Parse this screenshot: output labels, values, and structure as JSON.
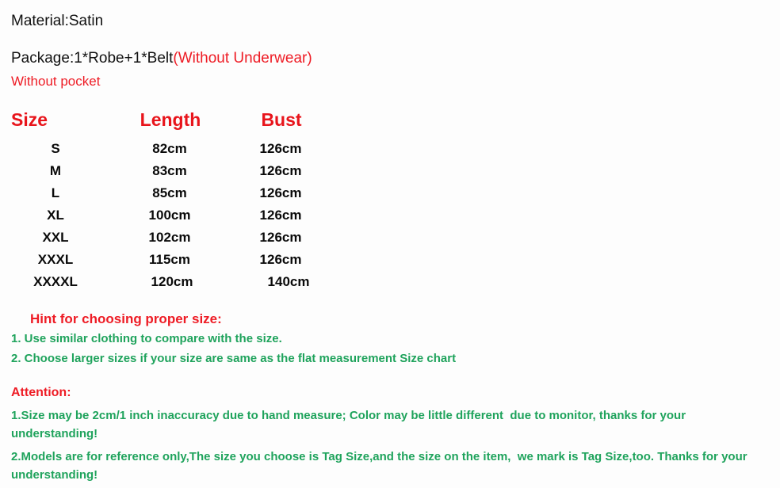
{
  "document": {
    "material_line": "Material:Satin",
    "package": {
      "main": "Package:1*Robe+1*Belt",
      "note": "(Without Underwear)"
    },
    "pocket_line": "Without pocket"
  },
  "size_chart": {
    "headers": {
      "size": "Size",
      "length": "Length",
      "bust": "Bust"
    },
    "rows": [
      {
        "size": "S",
        "length": "82cm",
        "bust": "126cm"
      },
      {
        "size": "M",
        "length": "83cm",
        "bust": "126cm"
      },
      {
        "size": "L",
        "length": "85cm",
        "bust": "126cm"
      },
      {
        "size": "XL",
        "length": "100cm",
        "bust": "126cm"
      },
      {
        "size": "XXL",
        "length": "102cm",
        "bust": "126cm"
      },
      {
        "size": "XXXL",
        "length": "115cm",
        "bust": "126cm"
      },
      {
        "size": "XXXXL",
        "length": "120cm",
        "bust": "140cm"
      }
    ]
  },
  "hint": {
    "title": "Hint for choosing proper size:",
    "items": [
      "1. Use similar clothing to compare with the size.",
      "2. Choose larger sizes if your size are same as the flat measurement Size chart"
    ]
  },
  "attention": {
    "title": "Attention:",
    "items": [
      "1.Size may be 2cm/1 inch inaccuracy due to hand measure; Color may be little different  due to monitor, thanks for your understanding!",
      "2.Models are for reference only,The size you choose is Tag Size,and the size on the item,  we mark is Tag Size,too. Thanks for your understanding!"
    ]
  },
  "colors": {
    "red": "#ee1c25",
    "header_red": "#e8141b",
    "green": "#1fa35c",
    "black": "#0a0a0a",
    "background": "#fdfdfd"
  }
}
